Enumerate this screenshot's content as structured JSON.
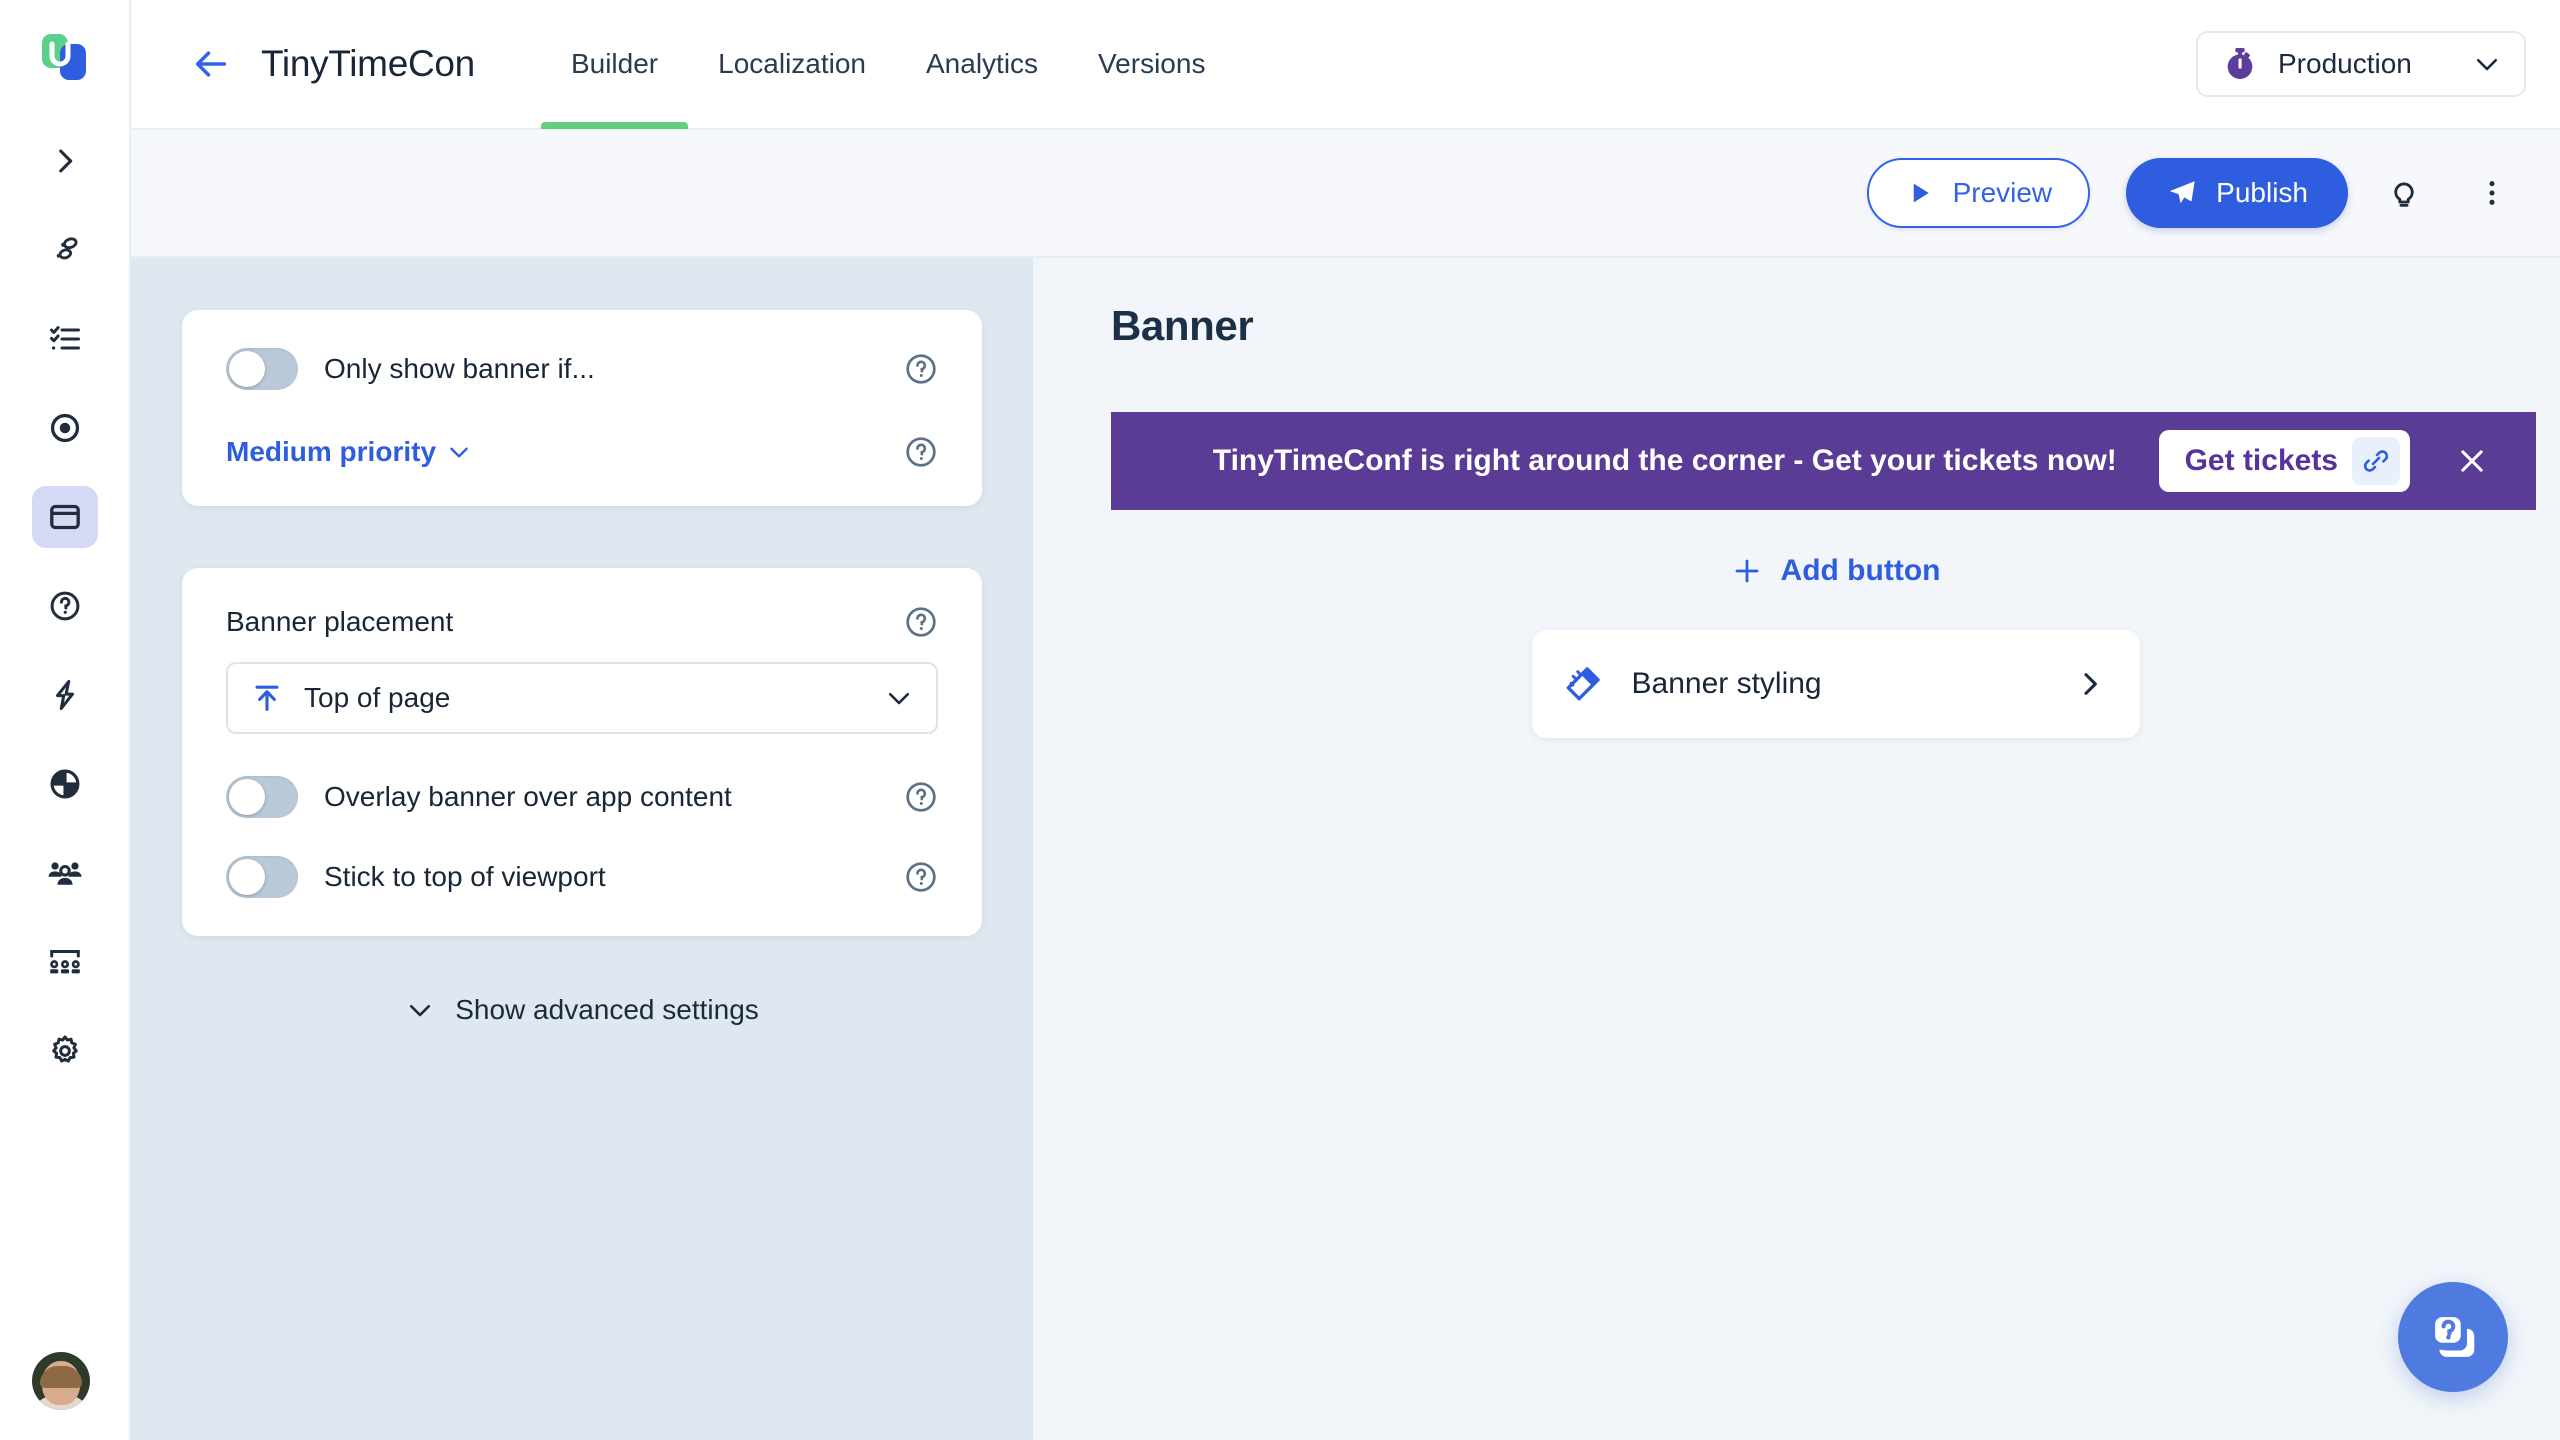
{
  "colors": {
    "brand_blue": "#2f5de0",
    "accent_green": "#63ce7e",
    "banner_purple": "#5a3b96",
    "panel_bg": "#dfe7f0",
    "canvas_bg": "#f2f6fa"
  },
  "rail": {
    "logo_name": "userflow-logo",
    "items": [
      {
        "name": "expand-sidebar-icon",
        "label": "Expand"
      },
      {
        "name": "footsteps-icon",
        "label": "Flows"
      },
      {
        "name": "checklist-icon",
        "label": "Checklists"
      },
      {
        "name": "target-icon",
        "label": "Launchers"
      },
      {
        "name": "banner-icon",
        "label": "Banners"
      },
      {
        "name": "question-circle-icon",
        "label": "Resource center"
      },
      {
        "name": "lightning-icon",
        "label": "Events"
      },
      {
        "name": "pie-chart-icon",
        "label": "Analytics"
      },
      {
        "name": "users-icon",
        "label": "Users"
      },
      {
        "name": "segments-icon",
        "label": "Companies"
      },
      {
        "name": "gear-icon",
        "label": "Settings"
      }
    ],
    "active_index": 4,
    "avatar_label": "Account"
  },
  "topbar": {
    "back_label": "Back",
    "flow_title": "TinyTimeCon",
    "tabs": [
      {
        "label": "Builder",
        "active": true
      },
      {
        "label": "Localization",
        "active": false
      },
      {
        "label": "Analytics",
        "active": false
      },
      {
        "label": "Versions",
        "active": false
      }
    ],
    "environment": {
      "label": "Production",
      "icon": "stopwatch-icon",
      "chevron": "chevron-down-icon"
    }
  },
  "actionbar": {
    "preview_label": "Preview",
    "publish_label": "Publish",
    "tips_icon": "lightbulb-icon",
    "more_icon": "more-vertical-icon"
  },
  "config": {
    "card1": {
      "toggle_label": "Only show banner if...",
      "toggle_on": false,
      "priority_label": "Medium priority",
      "help_icon": "question-circle-icon"
    },
    "card2": {
      "placement_label": "Banner placement",
      "placement_value": "Top of page",
      "placement_icon": "arrow-to-top-icon",
      "overlay_label": "Overlay banner over app content",
      "overlay_on": false,
      "stick_label": "Stick to top of viewport",
      "stick_on": false
    },
    "advanced_label": "Show advanced settings"
  },
  "canvas": {
    "title": "Banner",
    "banner": {
      "message": "TinyTimeConf is right around the corner - Get your tickets now!",
      "button_label": "Get tickets",
      "button_link_icon": "link-icon",
      "close_icon": "close-icon"
    },
    "add_button_label": "Add button",
    "styling_label": "Banner styling",
    "styling_icon": "magic-wand-icon",
    "styling_chevron": "chevron-right-icon",
    "fab_icon": "resource-center-icon"
  }
}
